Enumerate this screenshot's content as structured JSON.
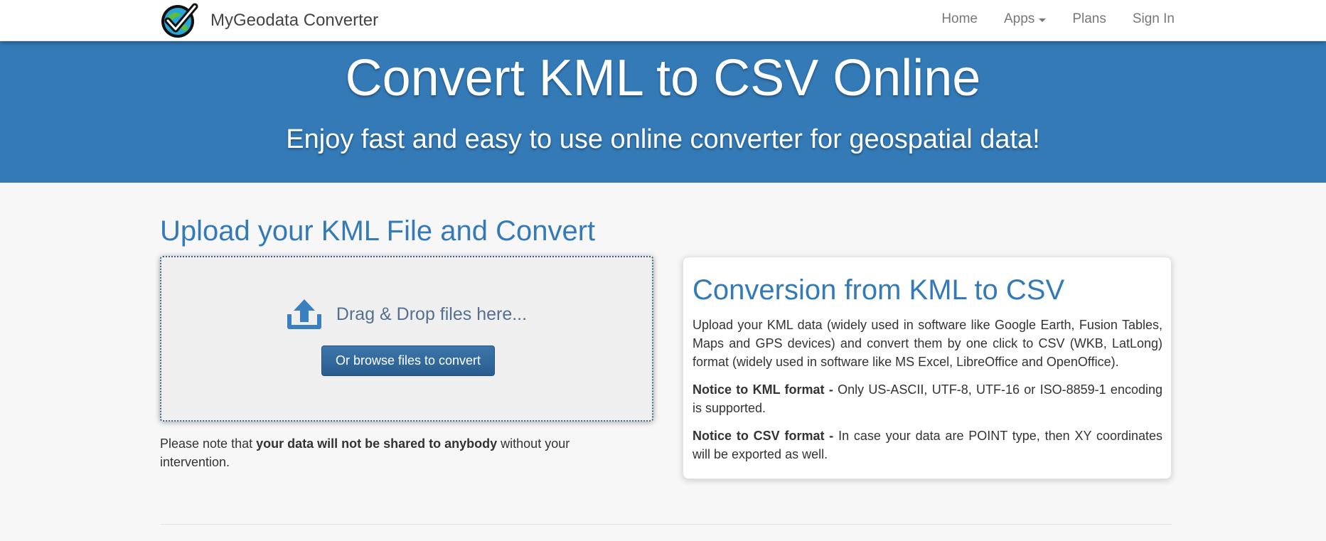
{
  "navbar": {
    "brand": "MyGeodata Converter",
    "links": [
      {
        "label": "Home"
      },
      {
        "label": "Apps",
        "has_dropdown": true
      },
      {
        "label": "Plans"
      },
      {
        "label": "Sign In"
      }
    ]
  },
  "hero": {
    "title": "Convert KML to CSV Online",
    "subtitle": "Enjoy fast and easy to use online converter for geospatial data!"
  },
  "upload": {
    "heading": "Upload your KML File and Convert",
    "drop_text": "Drag & Drop files here...",
    "browse_button": "Or browse files to convert",
    "note_prefix": "Please note that ",
    "note_bold": "your data will not be shared to anybody",
    "note_suffix": " without your intervention."
  },
  "info": {
    "title": "Conversion from KML to CSV",
    "paragraph": "Upload your KML data (widely used in software like Google Earth, Fusion Tables, Maps and GPS devices) and convert them by one click to CSV (WKB, LatLong) format (widely used in software like MS Excel, LibreOffice and OpenOffice).",
    "kml_notice_label": "Notice to KML format -",
    "kml_notice_text": " Only US-ASCII, UTF-8, UTF-16 or ISO-8859-1 encoding is supported.",
    "csv_notice_label": "Notice to CSV format -",
    "csv_notice_text": " In case your data are POINT type, then XY coordinates will be exported as well."
  },
  "icons": {
    "logo": "checkmark-globe-logo",
    "upload": "upload-icon",
    "dropdown": "caret-down-icon"
  },
  "colors": {
    "primary": "#337ab7",
    "button": "#2a5d8f",
    "navbar_bg": "#ffffff",
    "page_bg": "#f7f7f7"
  }
}
